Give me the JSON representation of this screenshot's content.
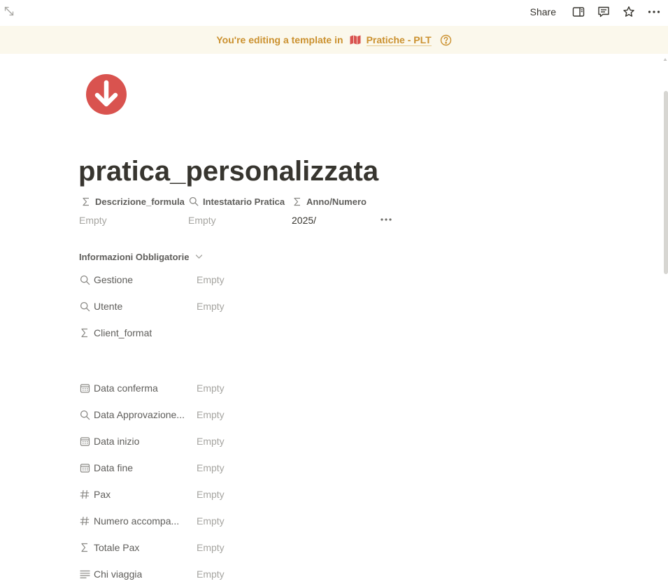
{
  "topbar": {
    "share_label": "Share",
    "icons": [
      "expand-icon",
      "sidebar-panel-icon",
      "comment-icon",
      "star-icon",
      "more-horizontal-icon"
    ]
  },
  "banner": {
    "prefix": "You're editing a template in",
    "database_name": "Pratiche - PLT",
    "database_icon": "map-icon",
    "help_icon": "help-circle-icon",
    "color": "#cb912f"
  },
  "page": {
    "icon": "arrow-down-circle-icon",
    "icon_color": "#d9534f",
    "title": "pratica_personalizzata"
  },
  "top_properties": [
    {
      "name": "Descrizione_formula",
      "icon": "formula-icon",
      "value": "Empty",
      "empty": true
    },
    {
      "name": "Intestatario Pratica",
      "icon": "search-icon",
      "value": "Empty",
      "empty": true
    },
    {
      "name": "Anno/Numero",
      "icon": "formula-icon",
      "value": "2025/",
      "empty": false
    }
  ],
  "section": {
    "title": "Informazioni Obbligatorie",
    "chevron": "chevron-down-icon"
  },
  "properties": [
    {
      "name": "Gestione",
      "icon": "search-icon",
      "value": "Empty"
    },
    {
      "name": "Utente",
      "icon": "search-icon",
      "value": "Empty"
    },
    {
      "name": "Client_format",
      "icon": "formula-icon",
      "value": ""
    },
    {
      "name": "Data conferma",
      "icon": "calendar-icon",
      "value": "Empty"
    },
    {
      "name": "Data Approvazione...",
      "icon": "search-icon",
      "value": "Empty"
    },
    {
      "name": "Data inizio",
      "icon": "calendar-icon",
      "value": "Empty"
    },
    {
      "name": "Data fine",
      "icon": "calendar-icon",
      "value": "Empty"
    },
    {
      "name": "Pax",
      "icon": "number-icon",
      "value": "Empty"
    },
    {
      "name": "Numero accompa...",
      "icon": "number-icon",
      "value": "Empty"
    },
    {
      "name": "Totale Pax",
      "icon": "formula-icon",
      "value": "Empty"
    },
    {
      "name": "Chi viaggia",
      "icon": "text-lines-icon",
      "value": "Empty"
    }
  ]
}
